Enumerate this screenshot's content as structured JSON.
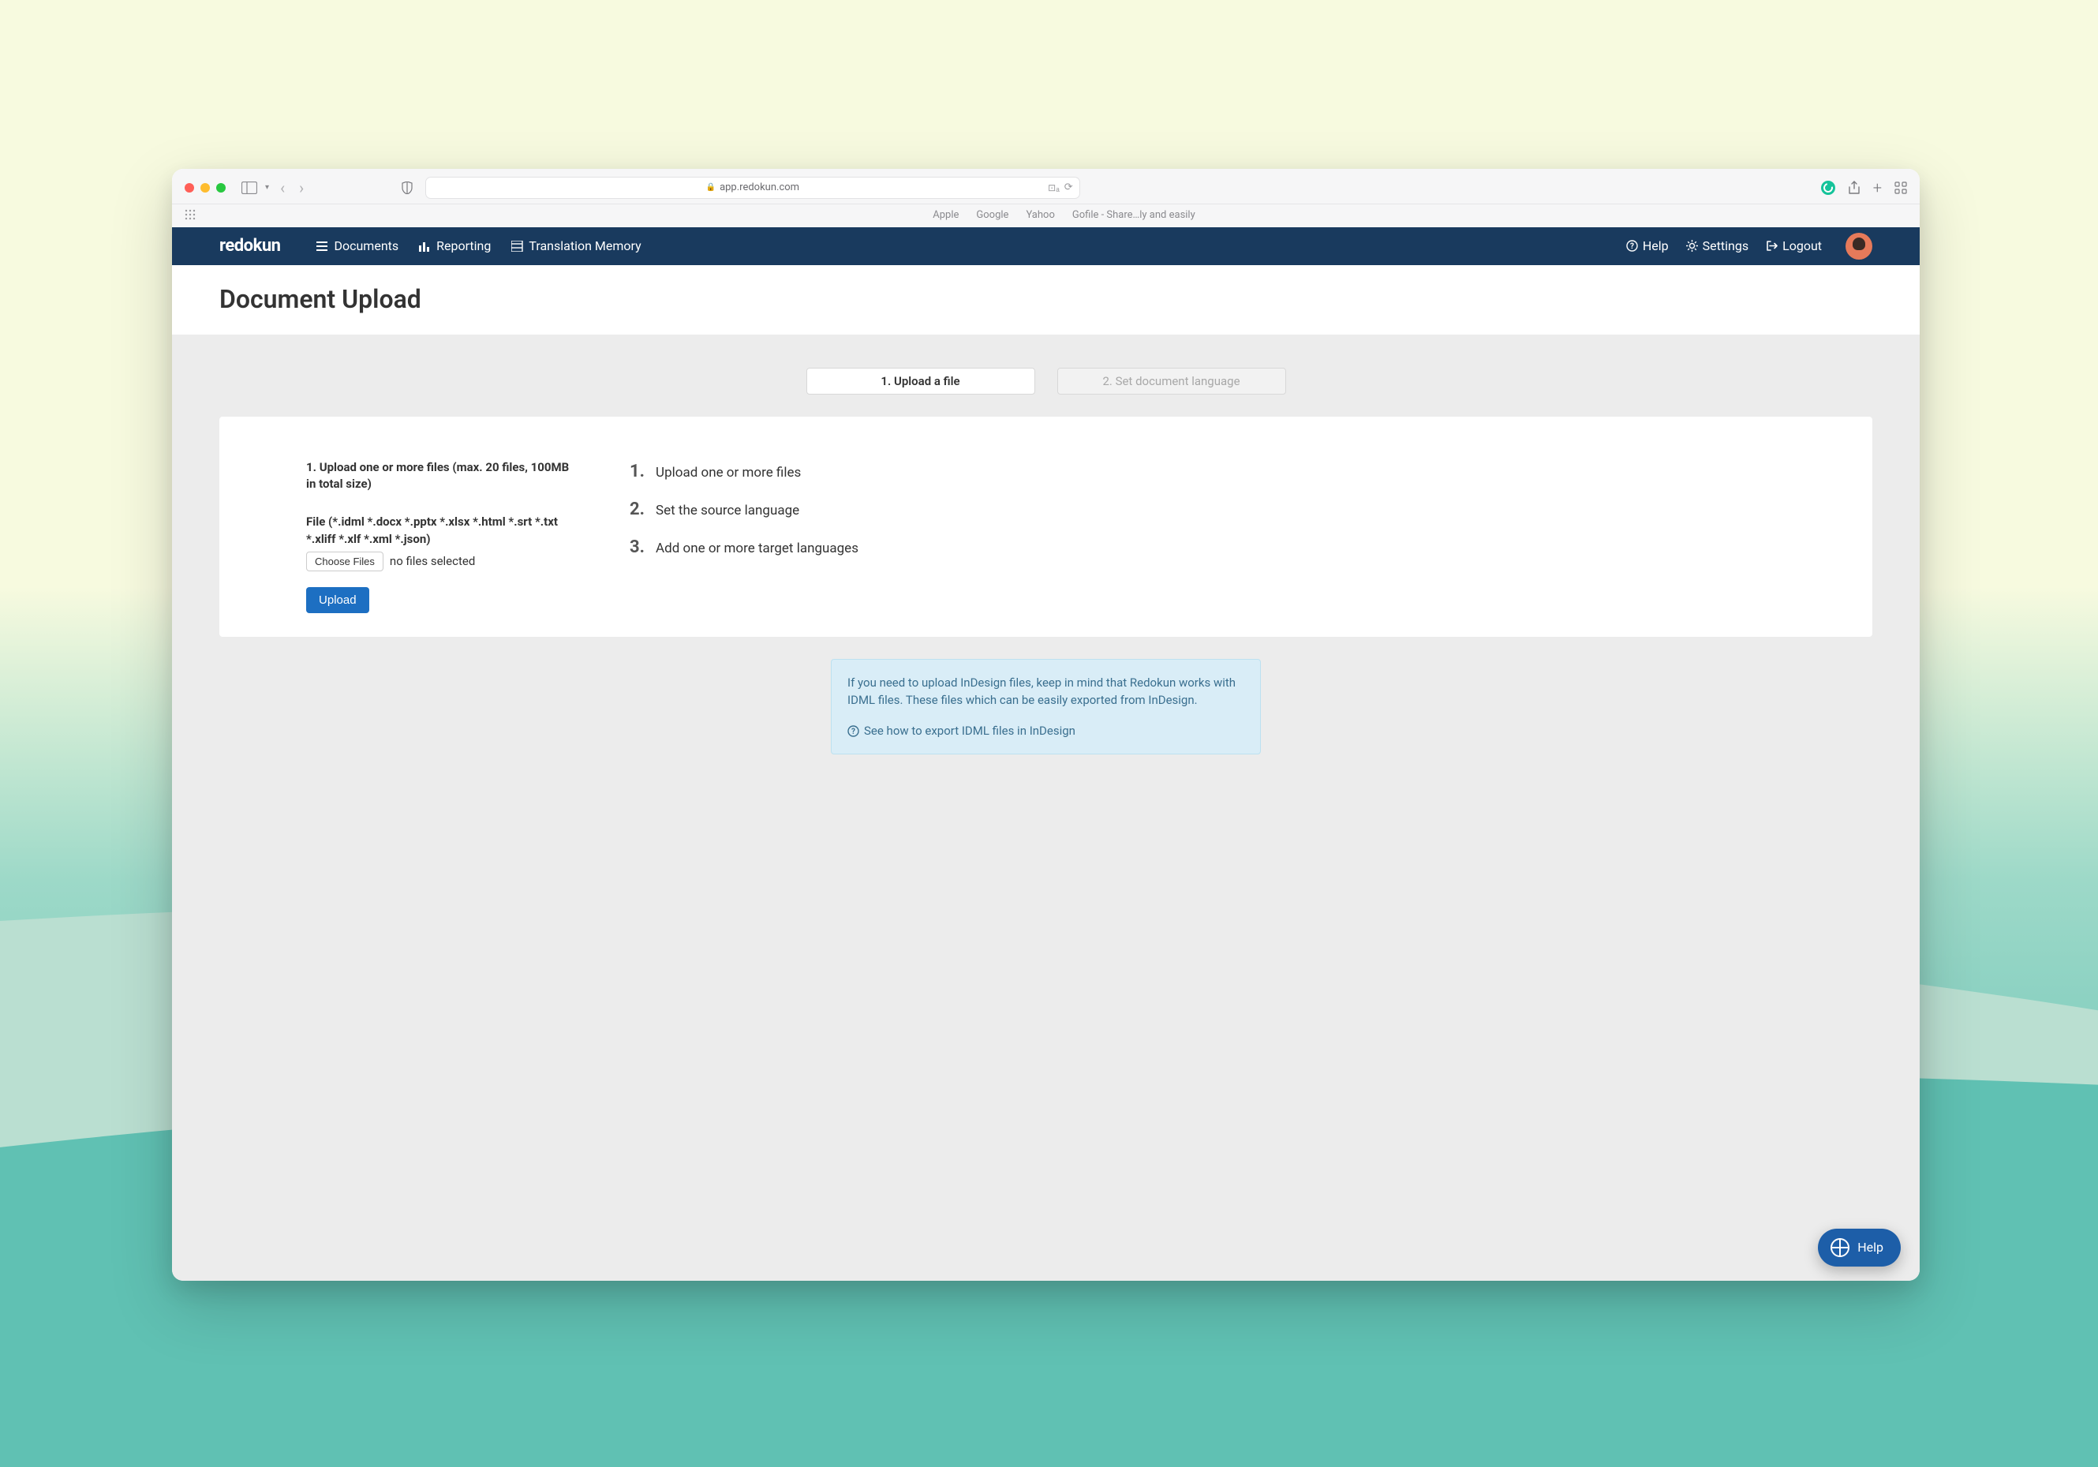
{
  "browser": {
    "url": "app.redokun.com",
    "bookmarks": [
      "Apple",
      "Google",
      "Yahoo",
      "Gofile - Share…ly and easily"
    ]
  },
  "nav": {
    "logo": "redokun",
    "items": [
      {
        "label": "Documents"
      },
      {
        "label": "Reporting"
      },
      {
        "label": "Translation Memory"
      }
    ],
    "right": {
      "help": "Help",
      "settings": "Settings",
      "logout": "Logout"
    }
  },
  "page": {
    "title": "Document Upload",
    "steps": [
      {
        "label": "1. Upload a file",
        "active": true
      },
      {
        "label": "2. Set document language",
        "active": false
      }
    ]
  },
  "upload": {
    "heading": "1. Upload one or more files (max. 20 files, 100MB in total size)",
    "filetypes": "File (*.idml *.docx *.pptx *.xlsx *.html *.srt *.txt *.xliff *.xlf *.xml *.json)",
    "choose_label": "Choose Files",
    "file_status": "no files selected",
    "upload_label": "Upload"
  },
  "instructions": [
    "Upload one or more files",
    "Set the source language",
    "Add one or more target languages"
  ],
  "info": {
    "text": "If you need to upload InDesign files, keep in mind that Redokun works with IDML files. These files which can be easily exported from InDesign.",
    "link": "See how to export IDML files in InDesign"
  },
  "fab": {
    "label": "Help"
  }
}
